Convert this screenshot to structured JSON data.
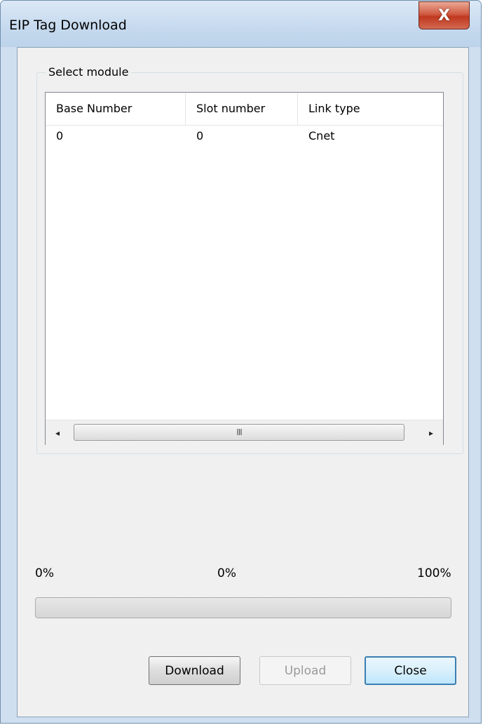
{
  "window": {
    "title": "EIP Tag Download",
    "close_glyph": "X"
  },
  "group": {
    "label": "Select module"
  },
  "table": {
    "columns": [
      "Base Number",
      "Slot number",
      "Link type"
    ],
    "rows": [
      [
        "0",
        "0",
        "Cnet"
      ]
    ]
  },
  "scrollbar": {
    "left_glyph": "◂",
    "right_glyph": "▸",
    "thumb_grip": "III"
  },
  "progress": {
    "label_left": "0%",
    "label_center": "0%",
    "label_right": "100%",
    "value": 0,
    "fill_color": "#2fb84a"
  },
  "buttons": {
    "download": "Download",
    "upload": "Upload",
    "close": "Close"
  },
  "icons": {
    "close": "close-icon",
    "scroll_left": "arrow-left-icon",
    "scroll_right": "arrow-right-icon"
  }
}
